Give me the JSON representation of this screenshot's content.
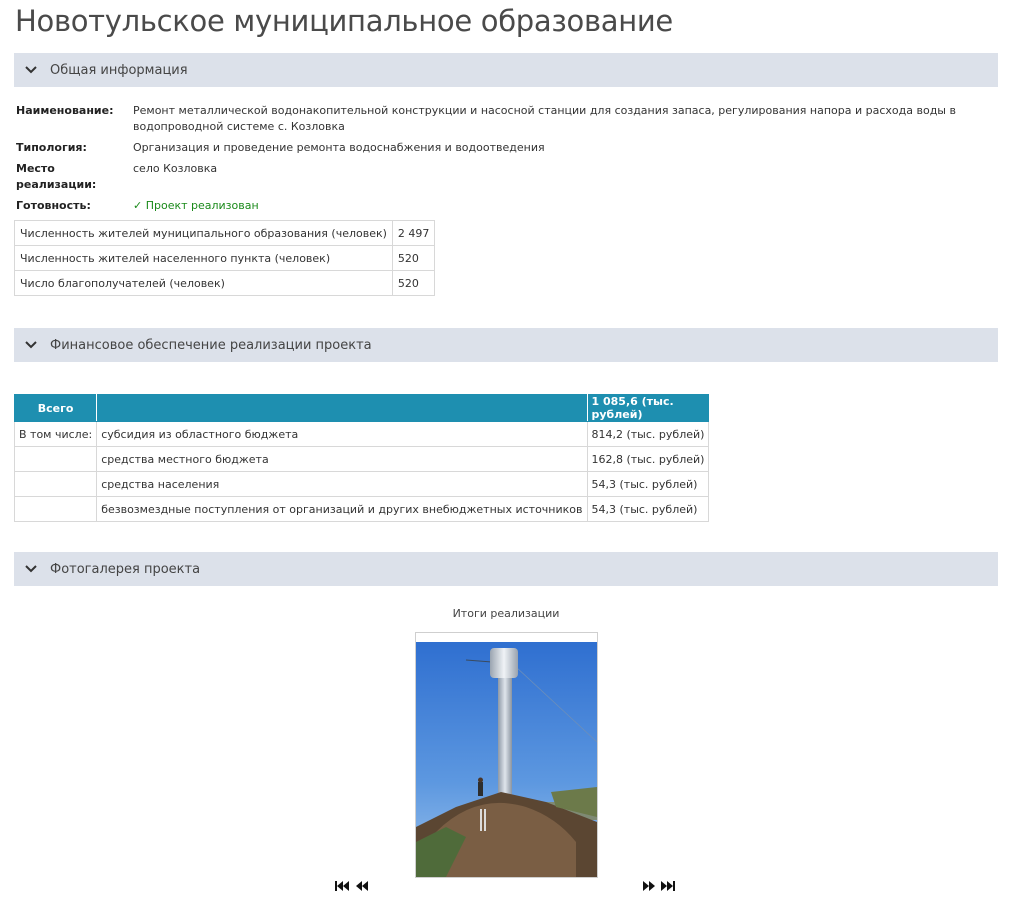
{
  "page_title": "Новотульское муниципальное образование",
  "sections": {
    "general": "Общая информация",
    "finance": "Финансовое обеспечение реализации проекта",
    "gallery": "Фотогалерея проекта"
  },
  "info": {
    "name_key": "Наименование:",
    "name_val": "Ремонт металлической водонакопительной конструкции и насосной станции для создания запаса, регулирования напора и расхода воды в  водопроводной системе с. Козловка",
    "type_key": "Типология:",
    "type_val": "Организация и проведение ремонта водоснабжения и водоотведения",
    "place_key": "Место реализации:",
    "place_val": "село Козловка",
    "ready_key": "Готовность:",
    "ready_val": "✓ Проект реализован"
  },
  "population": [
    {
      "label": "Численность жителей муниципального образования (человек)",
      "value": "2 497"
    },
    {
      "label": "Численность жителей населенного пункта (человек)",
      "value": "520"
    },
    {
      "label": "Число благополучателей (человек)",
      "value": "520"
    }
  ],
  "finance": {
    "total_label": "Всего",
    "total_value": "1 085,6 (тыс. рублей)",
    "including_label": "В том числе:",
    "rows": [
      {
        "label": "субсидия из областного бюджета",
        "value": "814,2 (тыс. рублей)"
      },
      {
        "label": "средства местного бюджета",
        "value": "162,8 (тыс. рублей)"
      },
      {
        "label": "средства населения",
        "value": "54,3 (тыс. рублей)"
      },
      {
        "label": "безвозмездные поступления от организаций и других внебюджетных источников",
        "value": "54,3 (тыс. рублей)"
      }
    ]
  },
  "gallery": {
    "caption": "Итоги реализации"
  },
  "icons": {
    "chevron": "chevron-down-icon",
    "first": "first-page-icon",
    "prev": "prev-icon",
    "next": "next-icon",
    "last": "last-page-icon"
  },
  "colors": {
    "section_bg": "#dce1ea",
    "table_header": "#1e8fb0",
    "ready_green": "#1a8a1a"
  }
}
